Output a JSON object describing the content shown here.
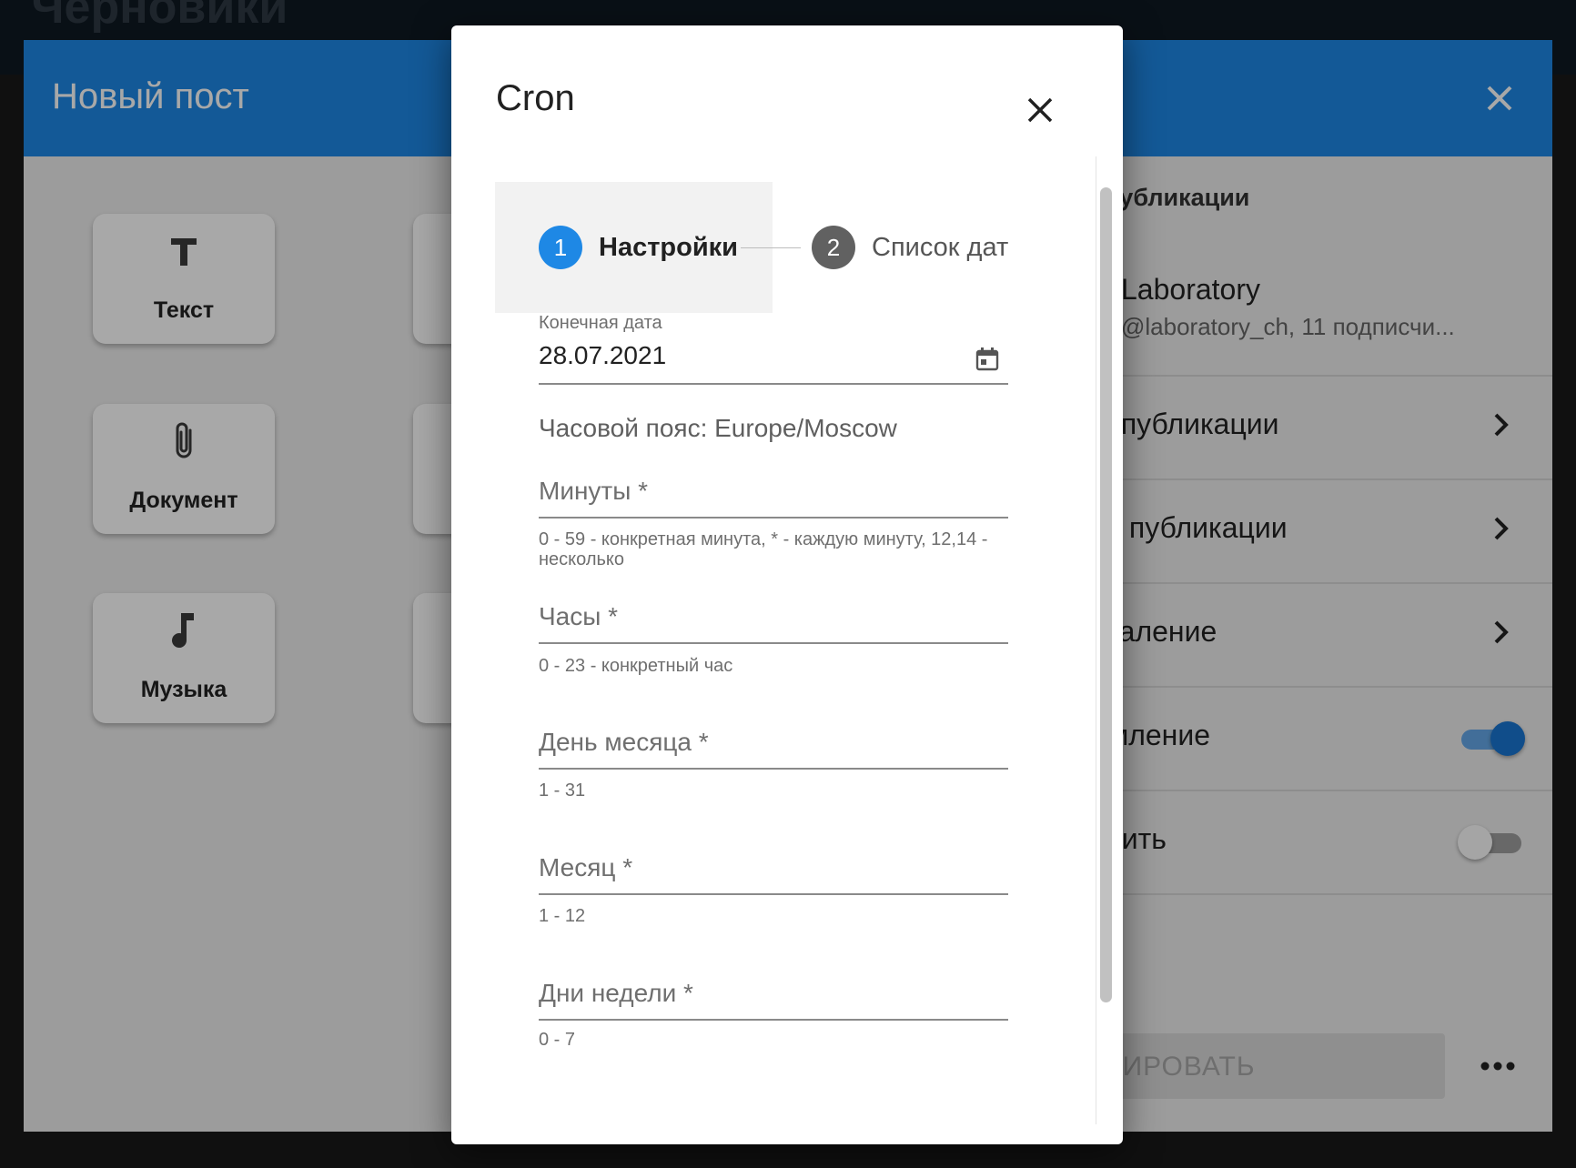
{
  "page": {
    "title": "Черновики"
  },
  "new_post": {
    "title": "Новый пост",
    "types": [
      {
        "label": "Текст",
        "icon": "text-icon"
      },
      {
        "label": "Документ",
        "icon": "paperclip-icon"
      },
      {
        "label": "Музыка",
        "icon": "music-note-icon"
      }
    ],
    "settings": {
      "heading": "публикации",
      "channel_name": "Laboratory",
      "channel_sub": "@laboratory_ch, 11 подписчи...",
      "rows": [
        {
          "label": "ремя публикации",
          "kind": "chevron"
        },
        {
          "label": "овтор публикации",
          "kind": "chevron"
        },
        {
          "label": "втоудаление",
          "kind": "chevron"
        },
        {
          "label": "ведомление",
          "kind": "switch",
          "on": true
        },
        {
          "label": "акрепить",
          "kind": "switch",
          "on": false
        }
      ],
      "schedule_button": "АПЛАНИРОВАТЬ",
      "more_icon": "more-horizontal-icon"
    }
  },
  "dialog": {
    "title": "Cron",
    "steps": [
      {
        "number": "1",
        "label": "Настройки",
        "active": true
      },
      {
        "number": "2",
        "label": "Список дат",
        "active": false
      }
    ],
    "end_date": {
      "label": "Конечная дата",
      "value": "28.07.2021",
      "icon": "calendar-icon"
    },
    "timezone": "Часовой пояс: Europe/Moscow",
    "fields": [
      {
        "label": "Минуты *",
        "hint": "0 - 59 - конкретная минута, * - каждую минуту, 12,14 - несколько"
      },
      {
        "label": "Часы *",
        "hint": "0 - 23 - конкретный час"
      },
      {
        "label": "День месяца *",
        "hint": "1 - 31"
      },
      {
        "label": "Месяц *",
        "hint": "1 - 12"
      },
      {
        "label": "Дни недели *",
        "hint": "0 - 7"
      }
    ]
  },
  "colors": {
    "primary": "#1e88e5",
    "inactive_step": "#616161",
    "switch_on_knob": "#1976d2",
    "switch_on_track": "#64a8e8"
  }
}
